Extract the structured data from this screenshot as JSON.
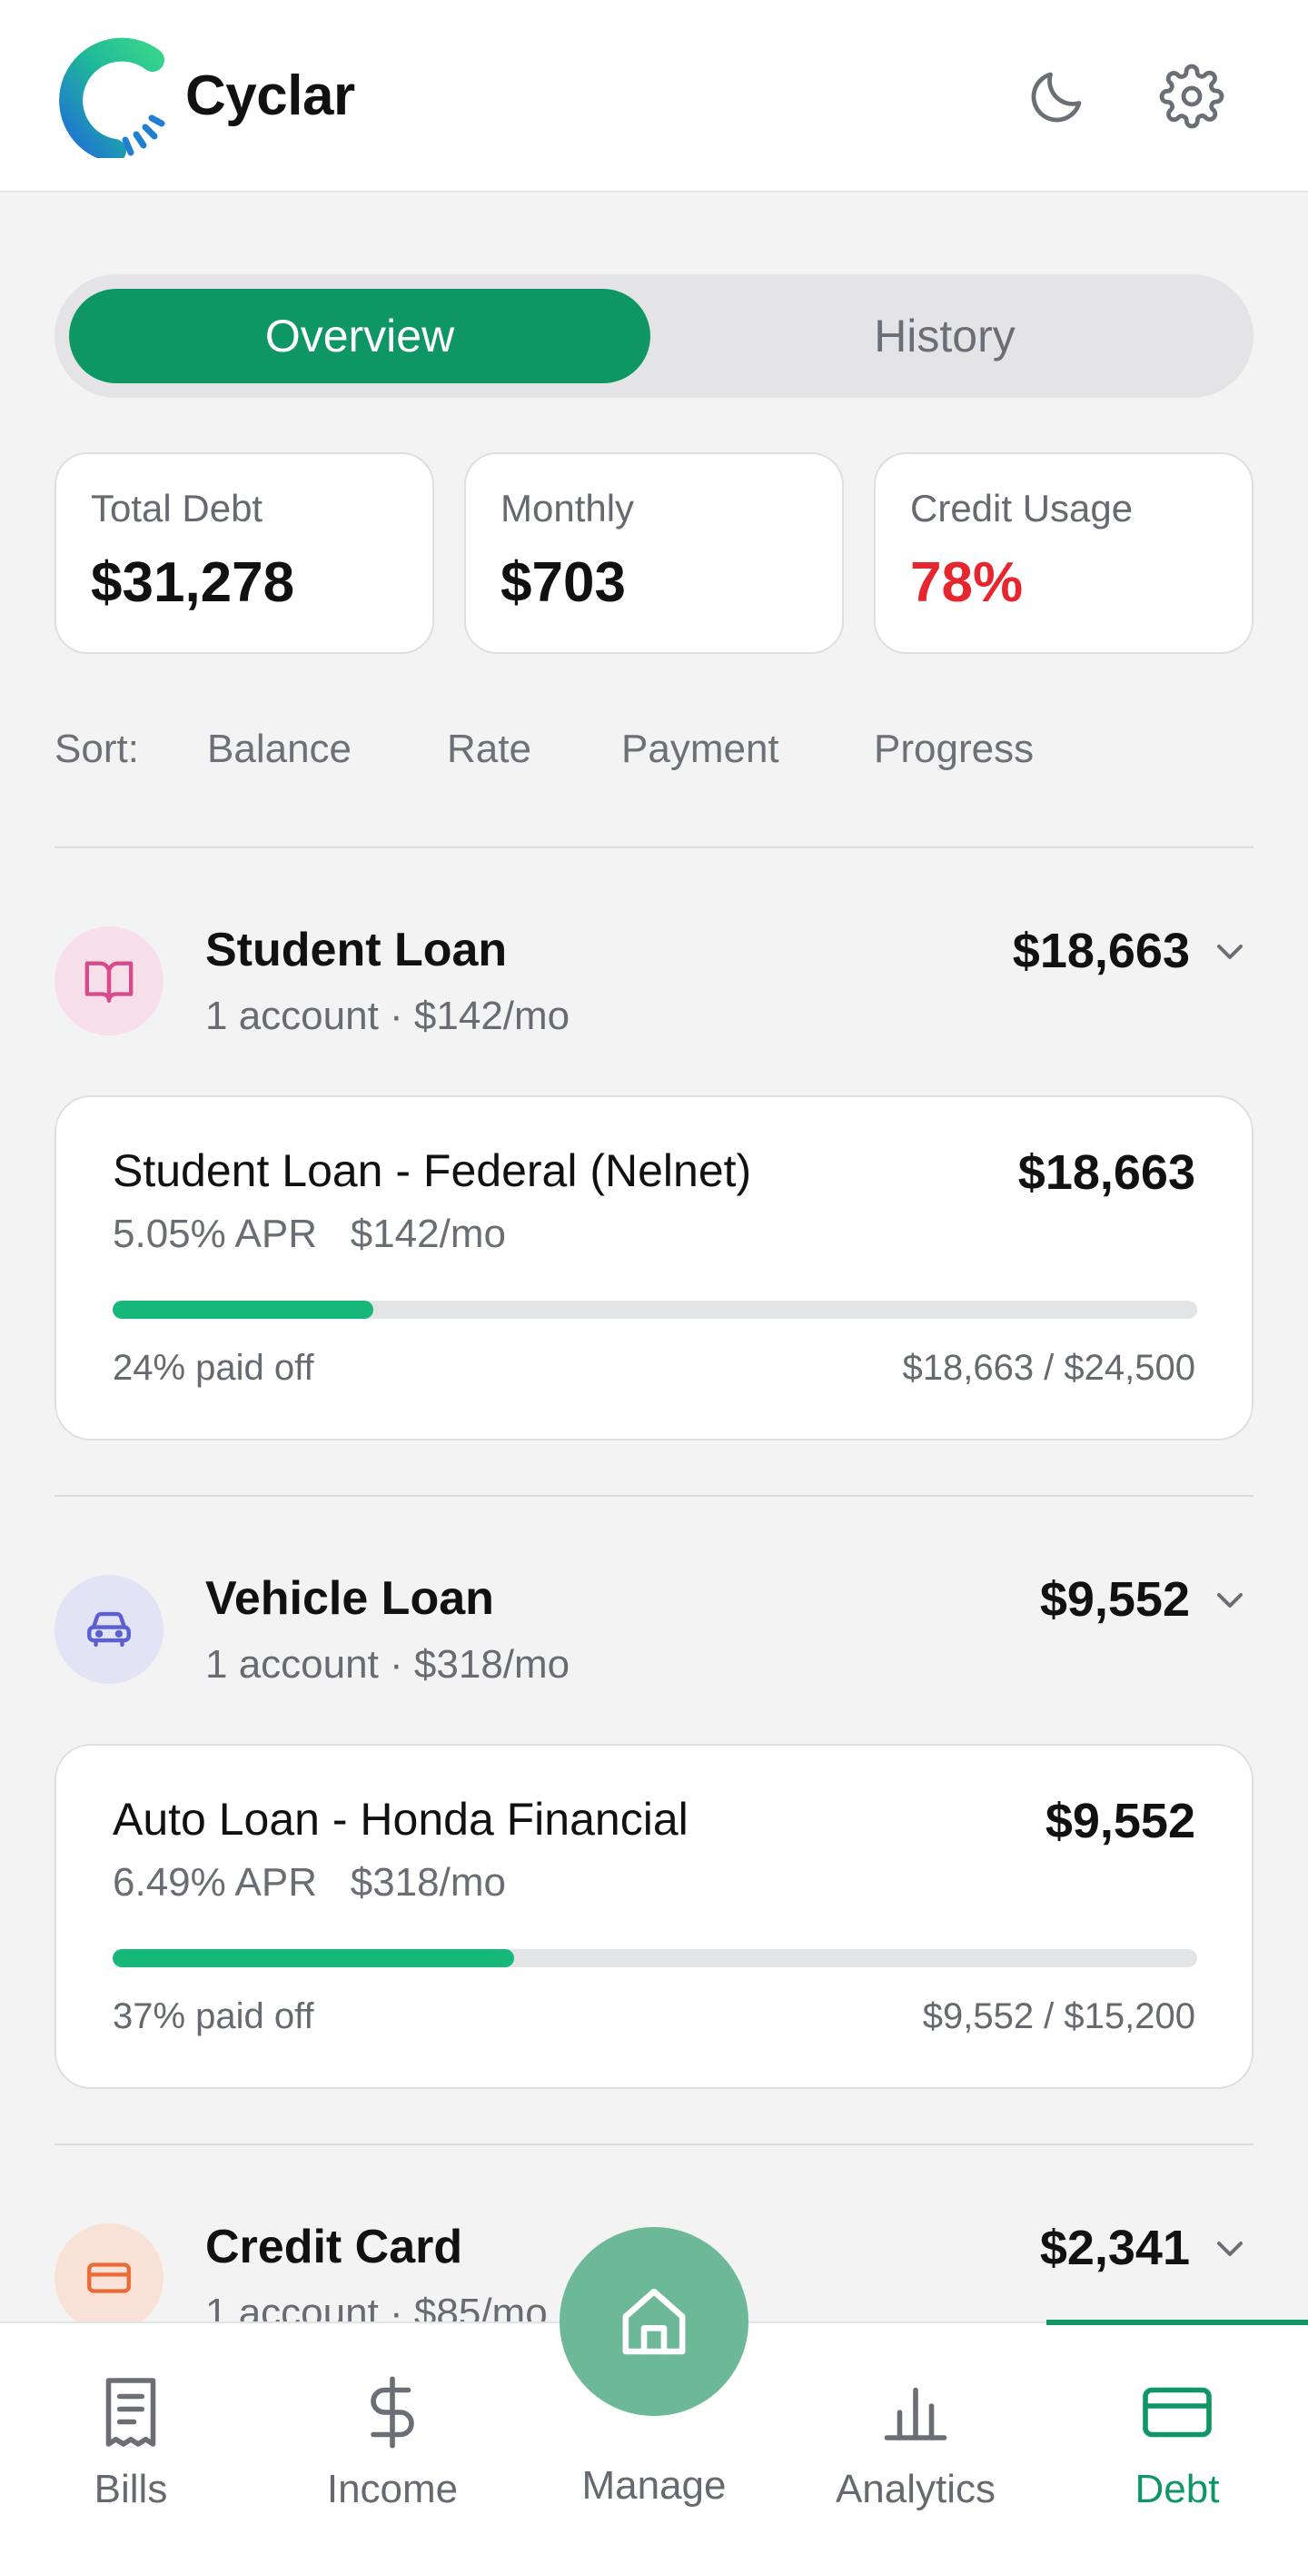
{
  "app": {
    "name": "Cyclar"
  },
  "header": {
    "theme_icon": "moon-icon",
    "settings_icon": "gear-icon"
  },
  "tabs": [
    {
      "label": "Overview",
      "active": true
    },
    {
      "label": "History",
      "active": false
    }
  ],
  "stats": [
    {
      "label": "Total Debt",
      "value": "$31,278"
    },
    {
      "label": "Monthly",
      "value": "$703"
    },
    {
      "label": "Credit Usage",
      "value": "78%",
      "color": "#e5262f"
    }
  ],
  "sort": {
    "label": "Sort:",
    "options": [
      "Balance",
      "Rate",
      "Payment",
      "Progress"
    ]
  },
  "groups": [
    {
      "title": "Student Loan",
      "subtitle": "1 account · $142/mo",
      "total": "$18,663",
      "icon": "book-icon",
      "icon_bg": "#f6dfe9",
      "icon_color": "#d84a8c",
      "accounts": [
        {
          "name": "Student Loan - Federal (Nelnet)",
          "balance": "$18,663",
          "apr": "5.05% APR",
          "payment": "$142/mo",
          "progress": 0.24,
          "progress_label": "24% paid off",
          "ratio": "$18,663 / $24,500"
        }
      ]
    },
    {
      "title": "Vehicle Loan",
      "subtitle": "1 account · $318/mo",
      "total": "$9,552",
      "icon": "car-icon",
      "icon_bg": "#e2e3f5",
      "icon_color": "#5b5fd0",
      "accounts": [
        {
          "name": "Auto Loan - Honda Financial",
          "balance": "$9,552",
          "apr": "6.49% APR",
          "payment": "$318/mo",
          "progress": 0.37,
          "progress_label": "37% paid off",
          "ratio": "$9,552 / $15,200"
        }
      ]
    },
    {
      "title": "Credit Card",
      "subtitle": "1 account · $85/mo",
      "total": "$2,341",
      "icon": "credit-card-icon",
      "icon_bg": "#f8e1d6",
      "icon_color": "#ec6a33"
    }
  ],
  "bottom_nav": [
    {
      "label": "Bills",
      "icon": "receipt-icon",
      "active": false
    },
    {
      "label": "Income",
      "icon": "dollar-icon",
      "active": false
    },
    {
      "label": "Manage",
      "icon": "home-icon",
      "active": false
    },
    {
      "label": "Analytics",
      "icon": "bar-chart-icon",
      "active": false
    },
    {
      "label": "Debt",
      "icon": "credit-card-icon",
      "active": true
    }
  ],
  "colors": {
    "accent": "#0f9665",
    "progress": "#17b77a",
    "danger": "#e5262f",
    "fab": "#6cb897"
  }
}
